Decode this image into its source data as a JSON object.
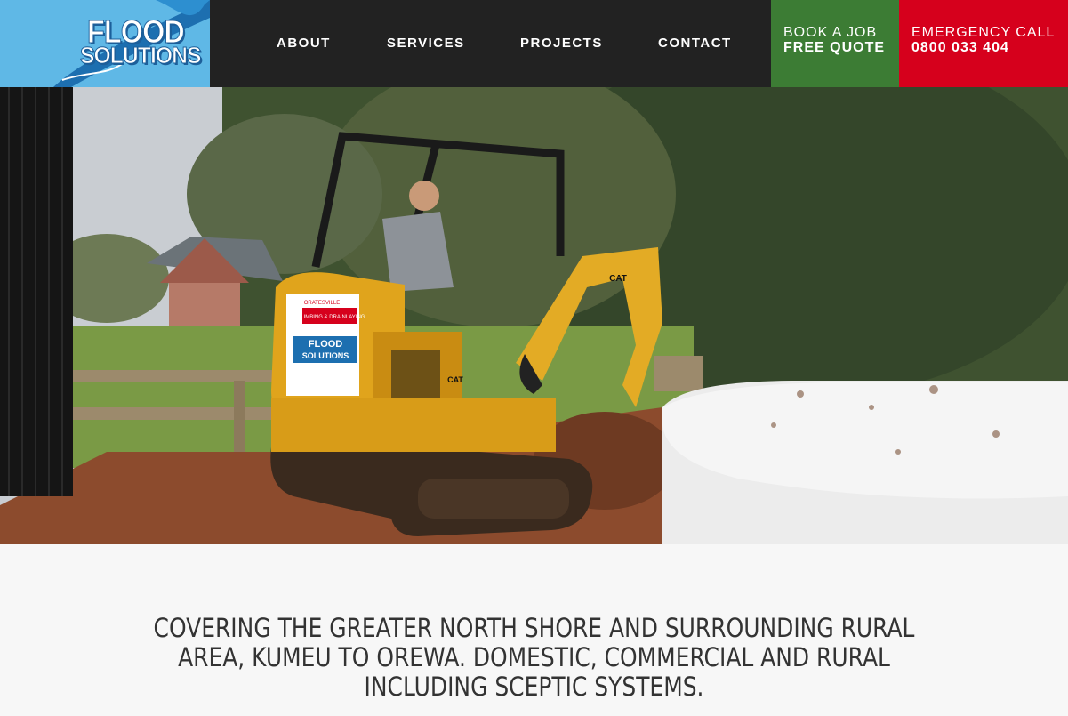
{
  "logo": {
    "line1": "FLOOD",
    "line2": "SOLUTIONS"
  },
  "nav": [
    "ABOUT",
    "SERVICES",
    "PROJECTS",
    "CONTACT"
  ],
  "cta_book": {
    "line1": "BOOK A JOB",
    "line2": "FREE QUOTE",
    "color": "#3c7c34"
  },
  "cta_emergency": {
    "line1": "EMERGENCY CALL",
    "line2": "0800 033 404",
    "color": "#d6001c"
  },
  "hero": {
    "sticker_top": "ORATESVILLE",
    "sticker_mid": "PLUMBING & DRAINLAYING",
    "sticker_brand1": "FLOOD",
    "sticker_brand2": "SOLUTIONS",
    "arm_brand": "CAT",
    "body_brand": "CAT"
  },
  "tagline": "COVERING THE GREATER NORTH SHORE AND SURROUNDING RURAL AREA, KUMEU TO OREWA. DOMESTIC, COMMERCIAL AND RURAL INCLUDING SCEPTIC SYSTEMS."
}
